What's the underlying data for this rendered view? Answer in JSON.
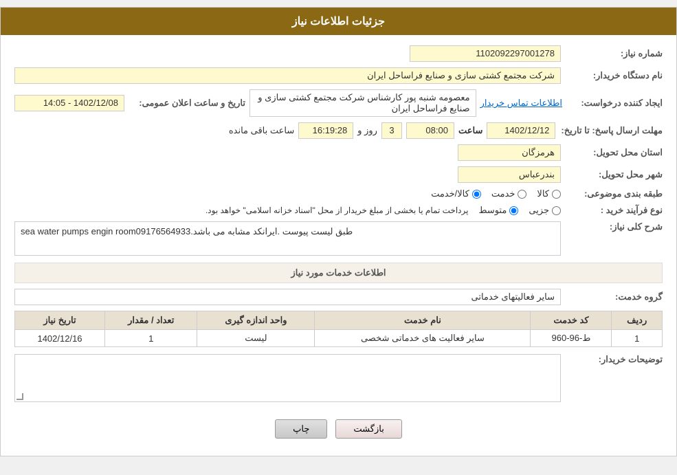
{
  "header": {
    "title": "جزئیات اطلاعات نیاز"
  },
  "fields": {
    "need_number_label": "شماره نیاز:",
    "need_number_value": "1102092297001278",
    "requester_org_label": "نام دستگاه خریدار:",
    "requester_org_value": "شرکت مجتمع کشتی سازی و صنایع فراساحل ایران",
    "creator_label": "ایجاد کننده درخواست:",
    "creator_value": "معصومه شنبه پور کارشناس شرکت مجتمع کشتی سازی و صنایع فراساحل ایران",
    "contact_link": "اطلاعات تماس خریدار",
    "date_announce_label": "تاریخ و ساعت اعلان عمومی:",
    "date_announce_value": "1402/12/08 - 14:05",
    "send_deadline_label": "مهلت ارسال پاسخ: تا تاریخ:",
    "send_deadline_date": "1402/12/12",
    "send_deadline_time": "08:00",
    "send_deadline_days": "3",
    "send_deadline_clock": "16:19:28",
    "send_deadline_remaining": "ساعت باقی مانده",
    "send_deadline_day_label": "روز و",
    "delivery_province_label": "استان محل تحویل:",
    "delivery_province_value": "هرمزگان",
    "delivery_city_label": "شهر محل تحویل:",
    "delivery_city_value": "بندرعباس",
    "category_label": "طبقه بندی موضوعی:",
    "category_options": [
      "کالا",
      "خدمت",
      "کالا/خدمت"
    ],
    "category_selected": "کالا/خدمت",
    "purchase_type_label": "نوع فرآیند خرید :",
    "purchase_type_options": [
      "جزیی",
      "متوسط"
    ],
    "purchase_type_note": "پرداخت تمام یا بخشی از مبلغ خریدار از محل \"اسناد خزانه اسلامی\" خواهد بود.",
    "description_label": "شرح کلی نیاز:",
    "description_value": "sea water pumps engin roomطبق لیست پیوست .ایرانکد مشابه می باشد.09176564933",
    "services_section_label": "اطلاعات خدمات مورد نیاز",
    "service_group_label": "گروه خدمت:",
    "service_group_value": "سایر فعالیتهای خدماتی",
    "table": {
      "headers": [
        "ردیف",
        "کد خدمت",
        "نام خدمت",
        "واحد اندازه گیری",
        "تعداد / مقدار",
        "تاریخ نیاز"
      ],
      "rows": [
        {
          "row": "1",
          "code": "ط-96-960",
          "name": "سایر فعالیت های خدماتی شخصی",
          "unit": "لیست",
          "quantity": "1",
          "date": "1402/12/16"
        }
      ]
    },
    "buyer_desc_label": "توضیحات خریدار:"
  },
  "buttons": {
    "print_label": "چاپ",
    "back_label": "بازگشت"
  }
}
